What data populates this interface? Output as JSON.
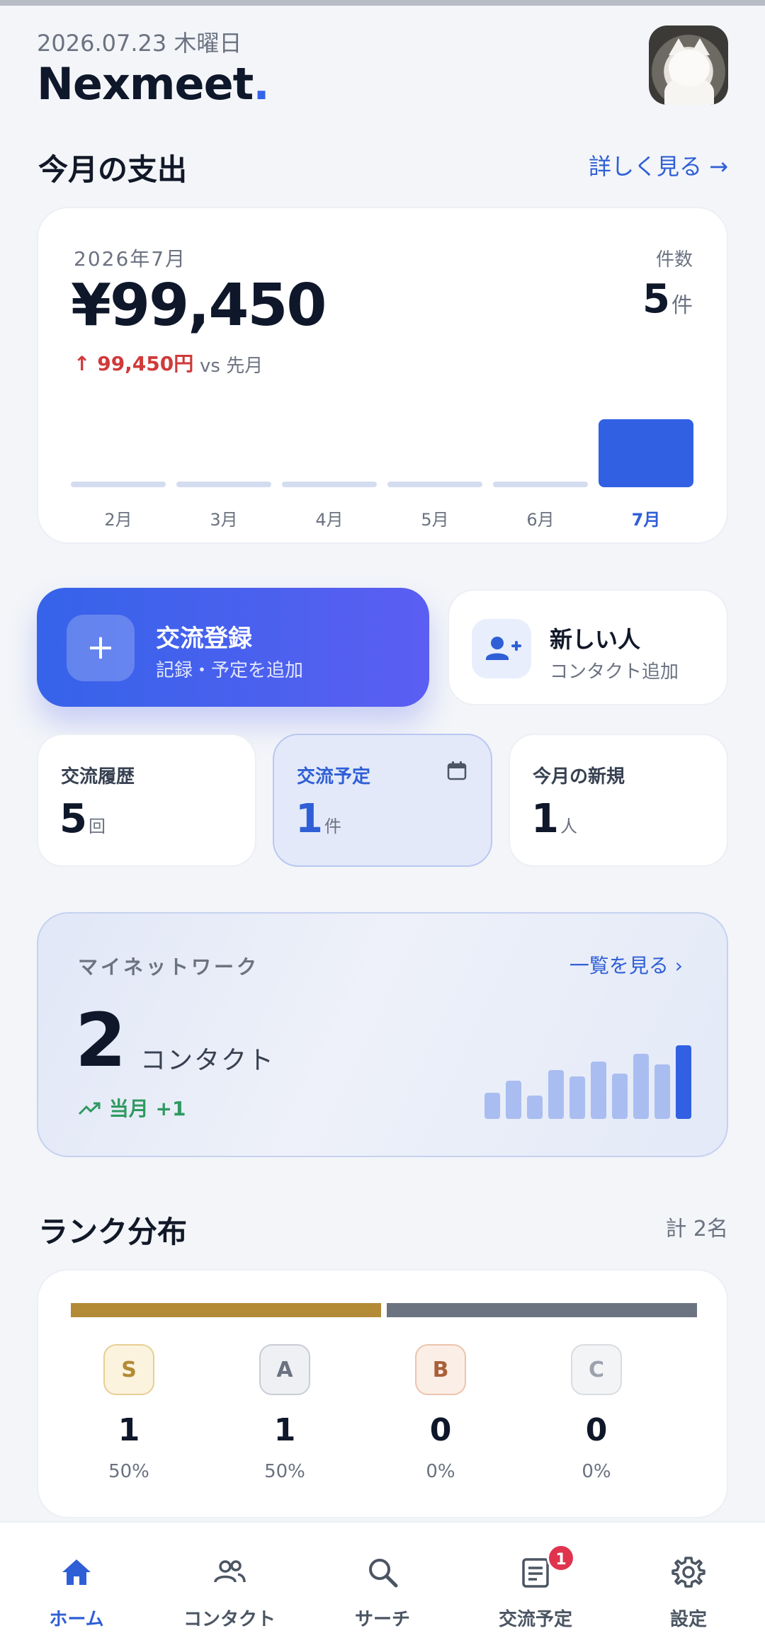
{
  "header": {
    "date": "2026.07.23 木曜日",
    "brand": "Nexmeet",
    "brand_dot": "."
  },
  "expense": {
    "section_title": "今月の支出",
    "detail_link": "詳しく見る →",
    "month": "2026年7月",
    "amount": "¥99,450",
    "change": "↑ 99,450円",
    "vs": "vs 先月",
    "count_label": "件数",
    "count": "5",
    "count_unit": "件"
  },
  "chart_data": {
    "type": "bar",
    "categories": [
      "2月",
      "3月",
      "4月",
      "5月",
      "6月",
      "7月"
    ],
    "values": [
      0,
      0,
      0,
      0,
      0,
      99450
    ],
    "title": "",
    "xlabel": "",
    "ylabel": "",
    "highlight_category": "7月",
    "colors": {
      "normal": "#d4dcf0",
      "highlight": "#3160e3"
    }
  },
  "actions": {
    "primary": {
      "title": "交流登録",
      "subtitle": "記録・予定を追加",
      "icon": "plus-icon"
    },
    "secondary": {
      "title": "新しい人",
      "subtitle": "コンタクト追加",
      "icon": "person-add-icon"
    }
  },
  "stats": [
    {
      "label": "交流履歴",
      "value": "5",
      "unit": "回"
    },
    {
      "label": "交流予定",
      "value": "1",
      "unit": "件",
      "icon": "calendar-icon"
    },
    {
      "label": "今月の新規",
      "value": "1",
      "unit": "人"
    }
  ],
  "network": {
    "label": "マイネットワーク",
    "link": "一覧を見る ›",
    "count": "2",
    "unit": "コンタクト",
    "trend": "当月 +1",
    "trend_icon": "trending-up-icon",
    "mini_bars": [
      0.36,
      0.52,
      0.32,
      0.66,
      0.58,
      0.78,
      0.62,
      0.88,
      0.74,
      1.0
    ]
  },
  "rank": {
    "section_title": "ランク分布",
    "total": "計 2名",
    "items": [
      {
        "rank": "S",
        "count": "1",
        "pct": "50%",
        "share": 0.5,
        "color": "#b38a35"
      },
      {
        "rank": "A",
        "count": "1",
        "pct": "50%",
        "share": 0.5,
        "color": "#6b7280"
      },
      {
        "rank": "B",
        "count": "0",
        "pct": "0%",
        "share": 0,
        "color": "#a9603a"
      },
      {
        "rank": "C",
        "count": "0",
        "pct": "0%",
        "share": 0,
        "color": "#9ca3af"
      }
    ]
  },
  "nav": {
    "items": [
      {
        "label": "ホーム",
        "icon": "home-icon",
        "active": true
      },
      {
        "label": "コンタクト",
        "icon": "people-icon"
      },
      {
        "label": "サーチ",
        "icon": "search-icon"
      },
      {
        "label": "交流予定",
        "icon": "schedule-icon",
        "badge": "1"
      },
      {
        "label": "設定",
        "icon": "gear-icon"
      }
    ],
    "accent": "#2f5fd6"
  }
}
